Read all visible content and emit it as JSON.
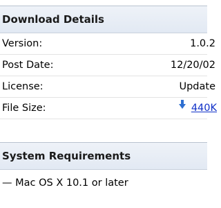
{
  "download_details": {
    "title": "Download Details",
    "rows": [
      {
        "label": "Version:",
        "value": "1.0.2"
      },
      {
        "label": "Post Date:",
        "value": "12/20/02"
      },
      {
        "label": "License:",
        "value": "Update"
      },
      {
        "label": "File Size:",
        "value": "440K"
      }
    ],
    "download_icon": "download-arrow-icon"
  },
  "system_requirements": {
    "title": "System Requirements",
    "items": [
      "— Mac OS X 10.1 or later"
    ]
  },
  "colors": {
    "header_bg": "#e6ecf5",
    "link": "#1030c8",
    "icon": "#2f6fd1"
  }
}
